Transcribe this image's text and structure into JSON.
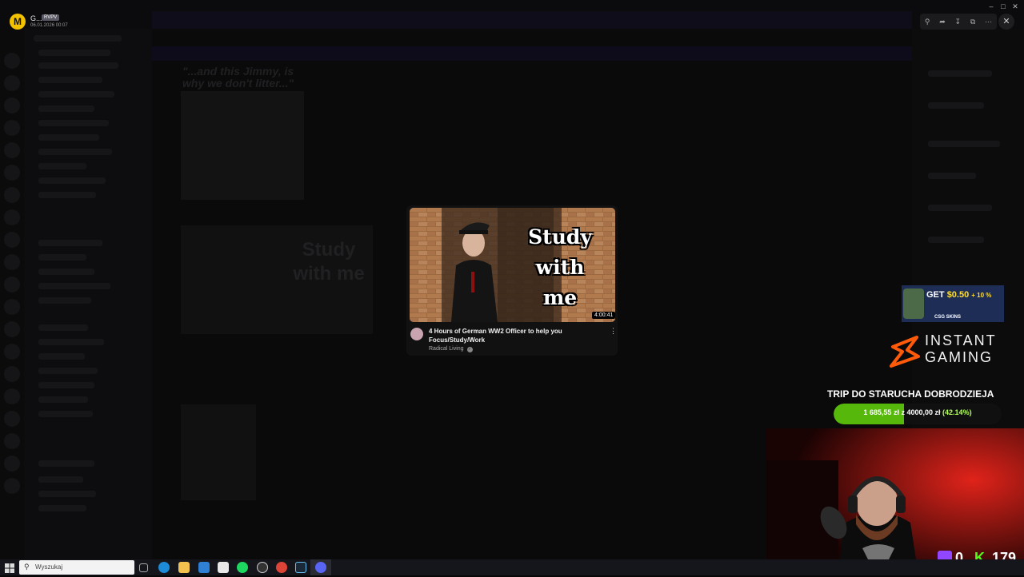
{
  "header": {
    "app_initial": "M",
    "user_name": "G...",
    "user_badge": "RVPV",
    "timestamp": "06.01.2026 00:07",
    "window_controls": [
      "minimize-icon",
      "maximize-icon",
      "close-icon"
    ],
    "viewer_tools": [
      "zoom-icon",
      "forward-icon",
      "download-icon",
      "open-external-icon",
      "more-icon"
    ]
  },
  "background": {
    "meme_caption": "\"...and this Jimmy, is why we don't litter...\"",
    "thumb_overlay": "Study with me"
  },
  "video_card": {
    "thumbnail_text": [
      "Study",
      "with",
      "me"
    ],
    "duration": "4:00:41",
    "title": "4 Hours of German WW2 Officer to help you Focus/Study/Work",
    "channel": "Radical Living",
    "verified_icon": "verified-check-icon"
  },
  "overlays": {
    "ad": {
      "get": "GET",
      "amount": "$0.50",
      "bonus": "+ 10 %",
      "brand": "CSG SKINS"
    },
    "sponsor_line1": "INSTANT",
    "sponsor_line2": "GAMING",
    "goal_title": "TRIP DO STARUCHA DOBRODZIEJA",
    "goal_current": "1 685,55 zł",
    "goal_separator": "z",
    "goal_target": "4000,00 zł",
    "goal_percent_label": "(42.14%)",
    "goal_fraction": 0.4214,
    "twitch_viewers": "0",
    "kick_viewers": "179",
    "colors": {
      "kick": "#53fc18",
      "twitch": "#9146ff",
      "goal_fill": "#57b80c"
    }
  },
  "taskbar": {
    "search_placeholder": "Wyszukaj",
    "apps": [
      "task-view-icon",
      "edge-icon",
      "file-explorer-icon",
      "store-icon",
      "calendar-icon",
      "spotify-icon",
      "obs-icon",
      "chrome-icon",
      "steam-icon",
      "discord-icon"
    ]
  }
}
